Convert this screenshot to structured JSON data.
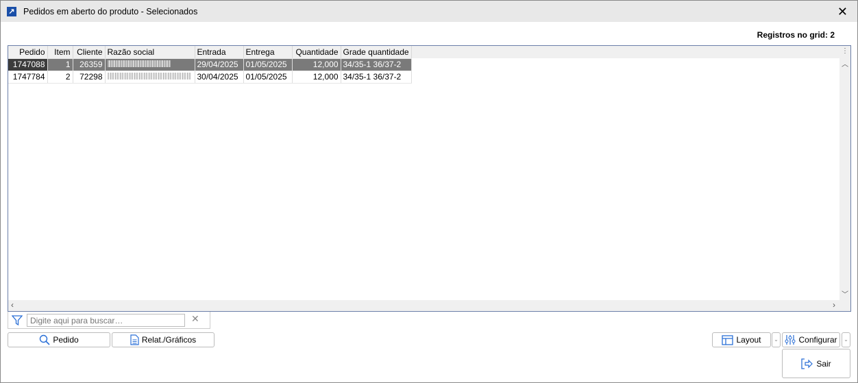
{
  "window": {
    "title": "Pedidos em aberto do produto - Selecionados",
    "close": "✕"
  },
  "registros": "Registros no grid: 2",
  "grid": {
    "columns": [
      "Pedido",
      "Item",
      "Cliente",
      "Razão social",
      "Entrada",
      "Entrega",
      "Quantidade",
      "Grade quantidade"
    ],
    "rows": [
      {
        "pedido": "1747088",
        "item": "1",
        "cliente": "26359",
        "entrada": "29/04/2025",
        "entrega": "01/05/2025",
        "quantidade": "12,000",
        "grade": "34/35-1 36/37-2",
        "selected": true
      },
      {
        "pedido": "1747784",
        "item": "2",
        "cliente": "72298",
        "entrada": "30/04/2025",
        "entrega": "01/05/2025",
        "quantidade": "12,000",
        "grade": "34/35-1 36/37-2",
        "selected": false
      }
    ]
  },
  "search": {
    "placeholder": "Digite aqui para buscar…"
  },
  "buttons": {
    "pedido": "Pedido",
    "relat": "Relat./Gráficos",
    "layout": "Layout",
    "configurar": "Configurar",
    "sair": "Sair"
  }
}
